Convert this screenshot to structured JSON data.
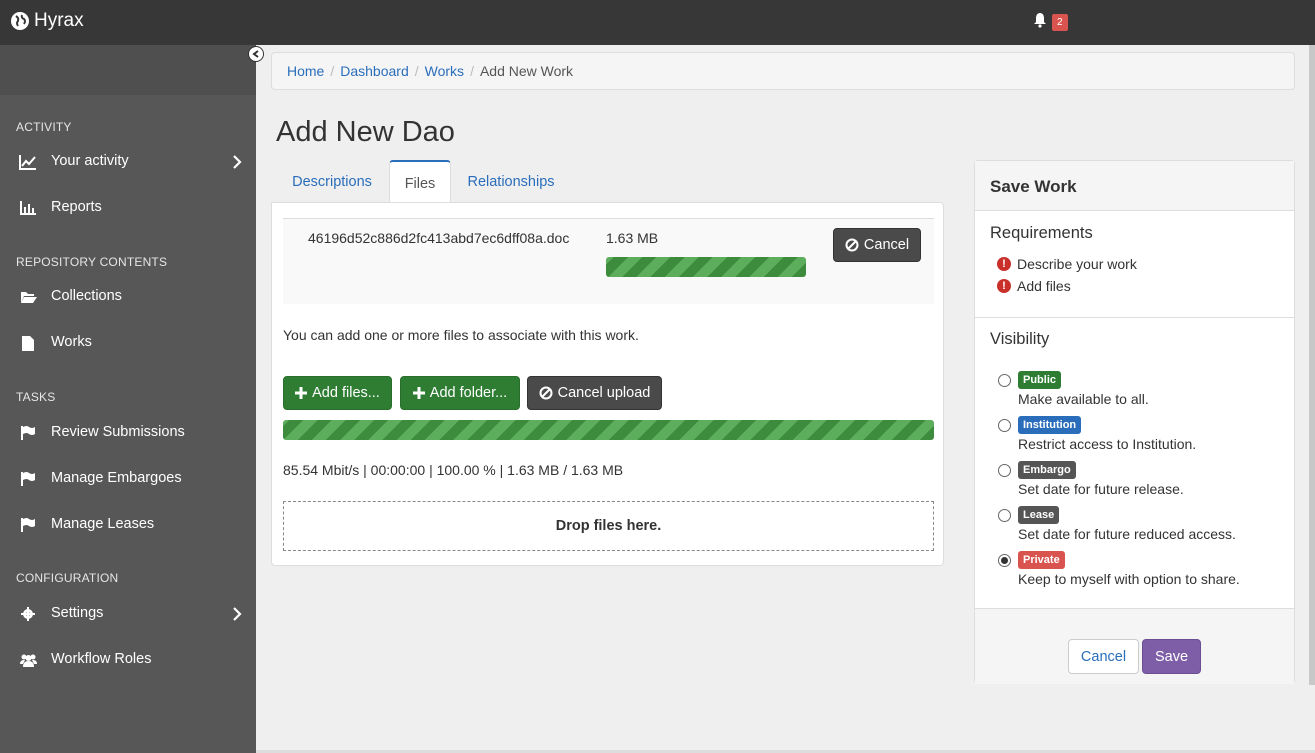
{
  "app": {
    "brand": "Hyrax",
    "notification_count": "2"
  },
  "sidebar": {
    "sections": [
      {
        "title": "ACTIVITY",
        "items": [
          {
            "label": "Your activity",
            "icon": "line-chart-icon",
            "has_submenu": true
          },
          {
            "label": "Reports",
            "icon": "bar-chart-icon",
            "has_submenu": false
          }
        ]
      },
      {
        "title": "REPOSITORY CONTENTS",
        "items": [
          {
            "label": "Collections",
            "icon": "folder-open-icon",
            "has_submenu": false
          },
          {
            "label": "Works",
            "icon": "file-icon",
            "has_submenu": false
          }
        ]
      },
      {
        "title": "TASKS",
        "items": [
          {
            "label": "Review Submissions",
            "icon": "flag-icon",
            "has_submenu": false
          },
          {
            "label": "Manage Embargoes",
            "icon": "flag-icon",
            "has_submenu": false
          },
          {
            "label": "Manage Leases",
            "icon": "flag-icon",
            "has_submenu": false
          }
        ]
      },
      {
        "title": "CONFIGURATION",
        "items": [
          {
            "label": "Settings",
            "icon": "gear-icon",
            "has_submenu": true
          },
          {
            "label": "Workflow Roles",
            "icon": "users-icon",
            "has_submenu": false
          }
        ]
      }
    ]
  },
  "breadcrumb": {
    "home": "Home",
    "dashboard": "Dashboard",
    "works": "Works",
    "current": "Add New Work",
    "separator": "/"
  },
  "page": {
    "title": "Add New Dao"
  },
  "tabs": [
    {
      "label": "Descriptions"
    },
    {
      "label": "Files"
    },
    {
      "label": "Relationships"
    }
  ],
  "files": {
    "uploaded": {
      "name": "46196d52c886d2fc413abd7ec6dff08a.doc",
      "size": "1.63 MB",
      "progress_percent": 100,
      "cancel_label": "Cancel"
    },
    "help_text": "You can add one or more files to associate with this work.",
    "add_files_label": "Add files...",
    "add_folder_label": "Add folder...",
    "cancel_upload_label": "Cancel upload",
    "overall_progress_percent": 100,
    "stats": "85.54 Mbit/s | 00:00:00 | 100.00 % | 1.63 MB / 1.63 MB",
    "drop_text": "Drop files here."
  },
  "save_work": {
    "title": "Save Work",
    "requirements_title": "Requirements",
    "requirements": [
      "Describe your work",
      "Add files"
    ],
    "visibility_title": "Visibility",
    "options": [
      {
        "badge": "Public",
        "desc": "Make available to all.",
        "color": "#2e7d32",
        "checked": false
      },
      {
        "badge": "Institution",
        "desc": "Restrict access to Institution.",
        "color": "#2a6ebb",
        "checked": false
      },
      {
        "badge": "Embargo",
        "desc": "Set date for future release.",
        "color": "#555555",
        "checked": false
      },
      {
        "badge": "Lease",
        "desc": "Set date for future reduced access.",
        "color": "#555555",
        "checked": false
      },
      {
        "badge": "Private",
        "desc": "Keep to myself with option to share.",
        "color": "#d9534f",
        "checked": true
      }
    ],
    "cancel_label": "Cancel",
    "save_label": "Save"
  }
}
